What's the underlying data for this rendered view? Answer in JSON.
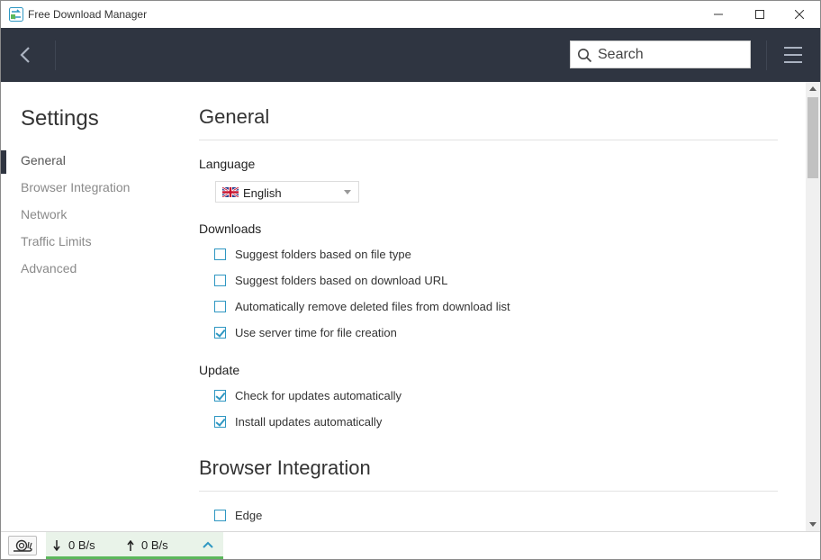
{
  "window": {
    "title": "Free Download Manager"
  },
  "toolbar": {
    "search_placeholder": "Search"
  },
  "settings": {
    "title": "Settings",
    "nav": [
      "General",
      "Browser Integration",
      "Network",
      "Traffic Limits",
      "Advanced"
    ],
    "active_nav": "General"
  },
  "general": {
    "title": "General",
    "language": {
      "label": "Language",
      "value": "English"
    },
    "downloads": {
      "label": "Downloads",
      "options": [
        {
          "label": "Suggest folders based on file type",
          "checked": false
        },
        {
          "label": "Suggest folders based on download URL",
          "checked": false
        },
        {
          "label": "Automatically remove deleted files from download list",
          "checked": false
        },
        {
          "label": "Use server time for file creation",
          "checked": true
        }
      ]
    },
    "update": {
      "label": "Update",
      "options": [
        {
          "label": "Check for updates automatically",
          "checked": true
        },
        {
          "label": "Install updates automatically",
          "checked": true
        }
      ]
    }
  },
  "browser_integration": {
    "title": "Browser Integration",
    "options": [
      {
        "label": "Edge",
        "checked": false
      }
    ]
  },
  "statusbar": {
    "download_speed": "0 B/s",
    "upload_speed": "0 B/s"
  },
  "colors": {
    "toolbar_bg": "#2f3541",
    "accent": "#2f97c2",
    "speed_bar": "#5cb85c"
  }
}
